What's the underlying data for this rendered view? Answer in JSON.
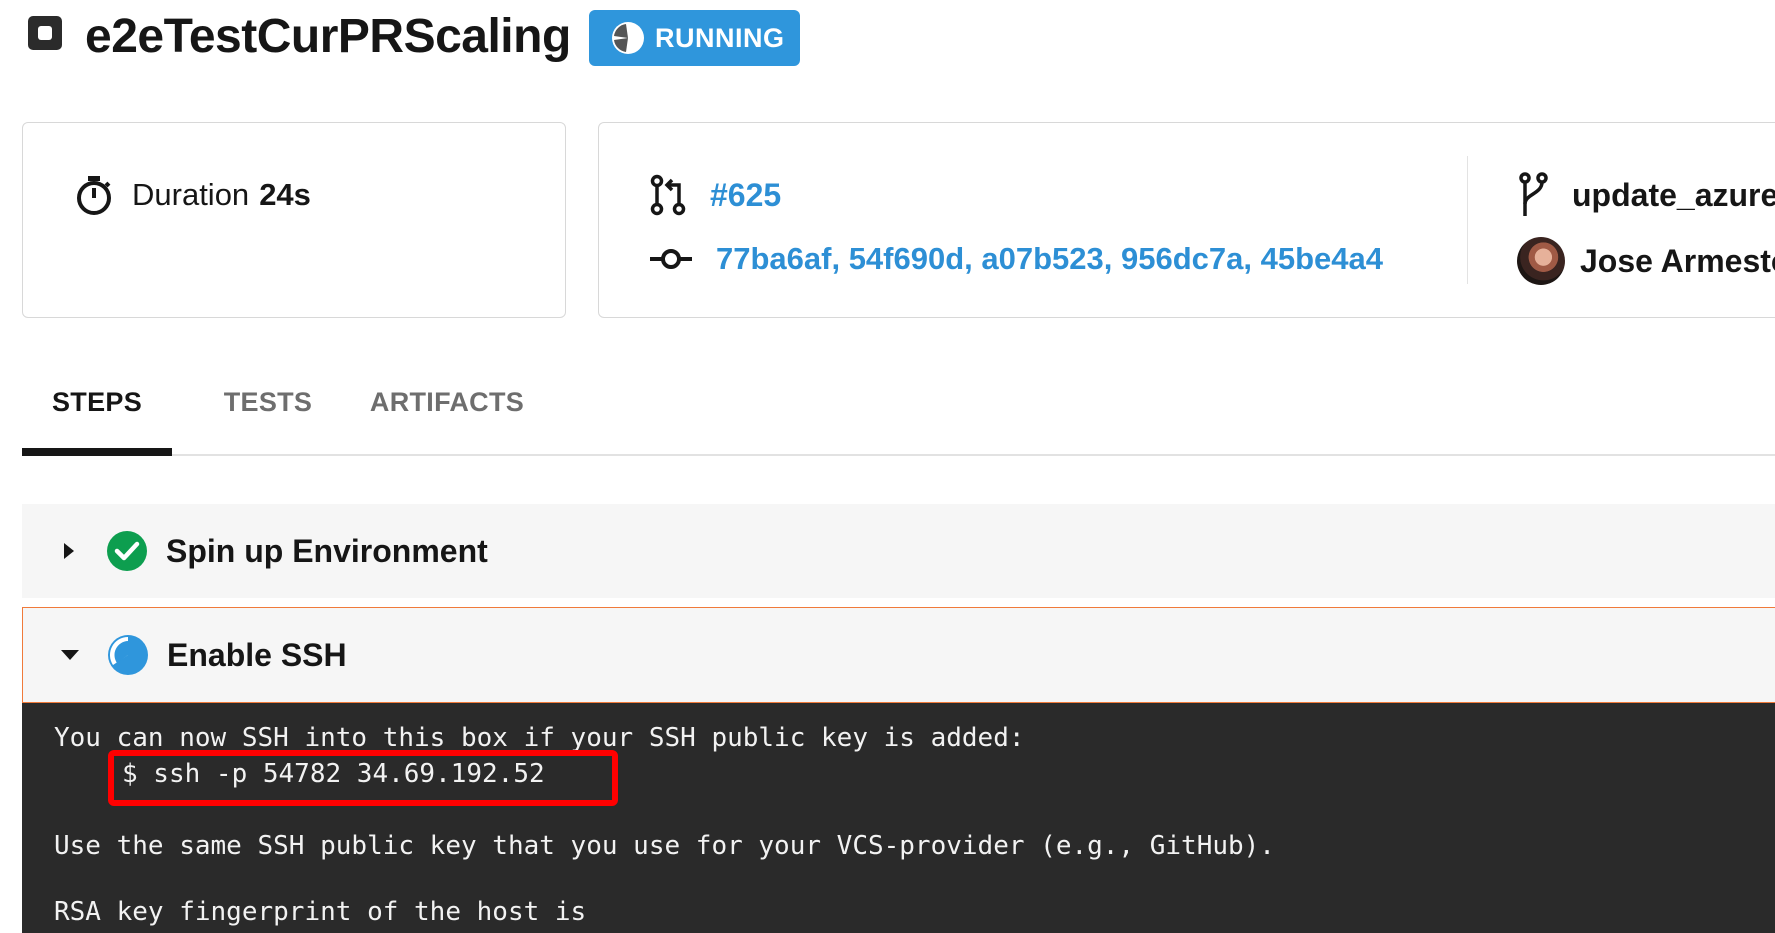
{
  "job": {
    "title": "e2eTestCurPRScaling",
    "status": "RUNNING",
    "status_color": "#2f96dc"
  },
  "summary": {
    "duration_label": "Duration",
    "duration_value": "24s",
    "pull_request": "#625",
    "commits": "77ba6af, 54f690d, a07b523, 956dc7a, 45be4a4",
    "branch": "update_azure",
    "author": "Jose Armesto"
  },
  "tabs": [
    {
      "label": "STEPS",
      "active": true
    },
    {
      "label": "TESTS",
      "active": false
    },
    {
      "label": "ARTIFACTS",
      "active": false
    }
  ],
  "steps": [
    {
      "name": "Spin up Environment",
      "status": "success",
      "expanded": false
    },
    {
      "name": "Enable SSH",
      "status": "running",
      "expanded": true
    }
  ],
  "terminal": {
    "lines": [
      "You can now SSH into this box if your SSH public key is added:",
      "$ ssh -p 54782 34.69.192.52",
      "Use the same SSH public key that you use for your VCS-provider (e.g., GitHub).",
      "RSA key fingerprint of the host is"
    ]
  },
  "colors": {
    "link": "#2d8fd5",
    "success": "#0d9e4f",
    "running": "#2f96dc",
    "active_step_border": "#f07a3a",
    "annotation": "#ff0000"
  }
}
